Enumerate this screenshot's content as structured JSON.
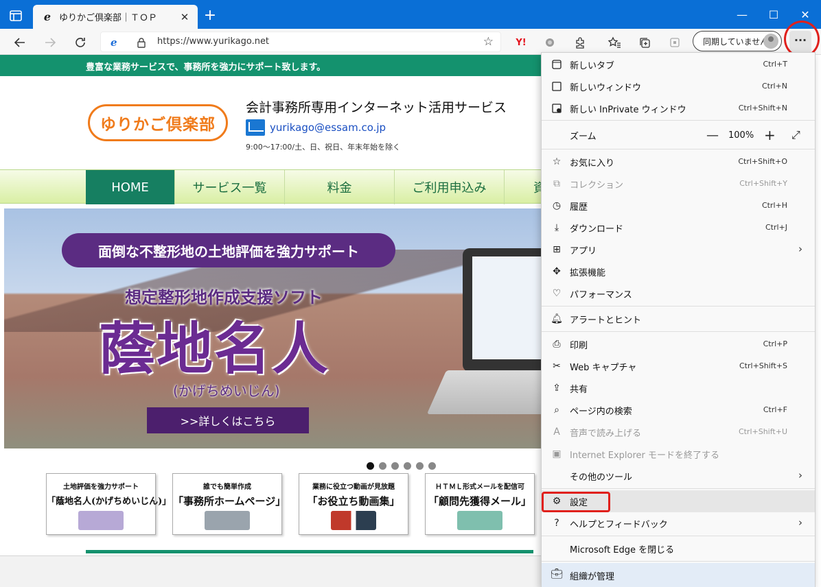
{
  "browser": {
    "tab_title": "ゆりかご倶楽部｜ＴＯＰ",
    "url": "https://www.yurikago.net",
    "sync_label": "同期していません",
    "menu_button": "···",
    "yahoo_label": "Y!"
  },
  "site": {
    "tagline": "豊富な業務サービスで、事務所を強力にサポート致します。",
    "logo_text": "ゆりかご倶楽部",
    "header_title": "会計事務所専用インターネット活用サービス",
    "email": "yurikago@essam.co.jp",
    "hours": "9:00〜17:00/土、日、祝日、年末年始を除く",
    "nav": [
      {
        "label": "HOME",
        "active": true
      },
      {
        "label": "サービス一覧",
        "active": false
      },
      {
        "label": "料金",
        "active": false
      },
      {
        "label": "ご利用申込み",
        "active": false
      },
      {
        "label": "資",
        "active": false
      }
    ],
    "hero": {
      "pill": "面倒な不整形地の土地評価を強力サポート",
      "subtitle": "想定整形地作成支援ソフト",
      "title": "蔭地名人",
      "reading": "(かげちめいじん)",
      "button": ">>詳しくはこちら"
    },
    "slider_dots": 6,
    "slider_active": 0,
    "banners": [
      {
        "top": "土地評価を強力サポート",
        "main": "「蔭地名人(かげちめいじん)」"
      },
      {
        "top": "誰でも簡単作成",
        "main": "「事務所ホームページ」"
      },
      {
        "top": "業務に役立つ動画が見放題",
        "main": "「お役立ち動画集」"
      },
      {
        "top": "ＨＴＭＬ形式メールを配信可",
        "main": "「顧問先獲得メール」"
      }
    ]
  },
  "menu": {
    "new_tab": {
      "label": "新しいタブ",
      "shortcut": "Ctrl+T"
    },
    "new_window": {
      "label": "新しいウィンドウ",
      "shortcut": "Ctrl+N"
    },
    "new_inprivate": {
      "label": "新しい InPrivate ウィンドウ",
      "shortcut": "Ctrl+Shift+N"
    },
    "zoom": {
      "label": "ズーム",
      "value": "100%",
      "minus": "—",
      "plus": "+"
    },
    "favorites": {
      "label": "お気に入り",
      "shortcut": "Ctrl+Shift+O"
    },
    "collections": {
      "label": "コレクション",
      "shortcut": "Ctrl+Shift+Y"
    },
    "history": {
      "label": "履歴",
      "shortcut": "Ctrl+H"
    },
    "downloads": {
      "label": "ダウンロード",
      "shortcut": "Ctrl+J"
    },
    "apps": {
      "label": "アプリ"
    },
    "extensions": {
      "label": "拡張機能"
    },
    "performance": {
      "label": "パフォーマンス"
    },
    "alerts": {
      "label": "アラートとヒント"
    },
    "print": {
      "label": "印刷",
      "shortcut": "Ctrl+P"
    },
    "web_capture": {
      "label": "Web キャプチャ",
      "shortcut": "Ctrl+Shift+S"
    },
    "share": {
      "label": "共有"
    },
    "find": {
      "label": "ページ内の検索",
      "shortcut": "Ctrl+F"
    },
    "read_aloud": {
      "label": "音声で読み上げる",
      "shortcut": "Ctrl+Shift+U"
    },
    "ie_mode": {
      "label": "Internet Explorer モードを終了する"
    },
    "more_tools": {
      "label": "その他のツール"
    },
    "settings": {
      "label": "設定"
    },
    "help": {
      "label": "ヘルプとフィードバック"
    },
    "close_edge": {
      "label": "Microsoft Edge を閉じる"
    },
    "managed": {
      "label": "組織が管理"
    }
  },
  "colors": {
    "titlebar": "#0a6fd6",
    "site_green": "#14926e",
    "hero_purple": "#5b2c82",
    "annotation_red": "#e0201c"
  }
}
